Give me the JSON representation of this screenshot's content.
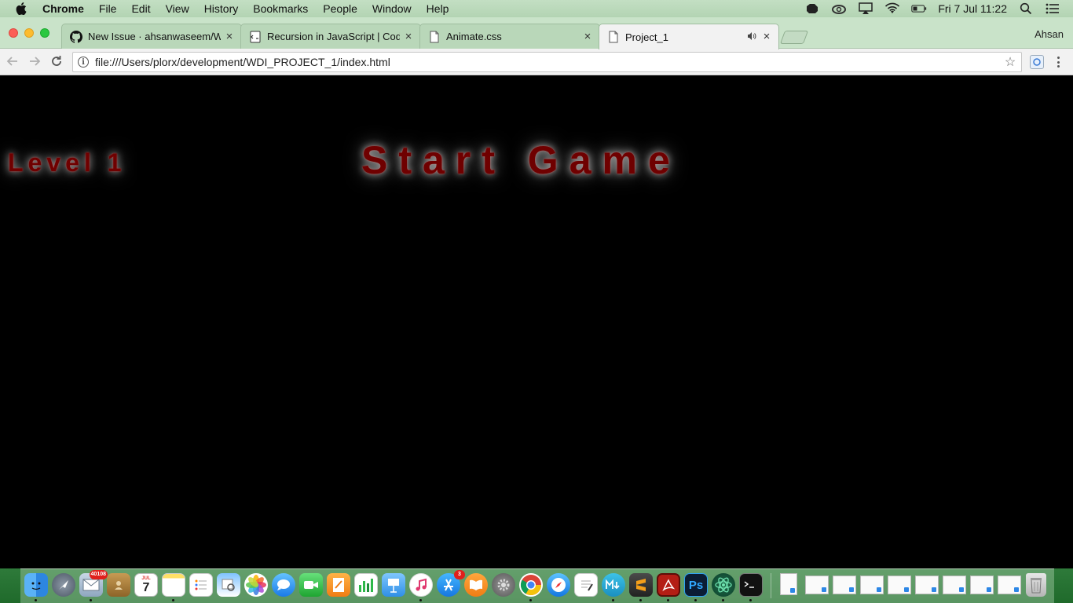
{
  "menubar": {
    "app_name": "Chrome",
    "items": [
      "File",
      "Edit",
      "View",
      "History",
      "Bookmarks",
      "People",
      "Window",
      "Help"
    ],
    "clock": "Fri 7 Jul  11:22"
  },
  "browser": {
    "profile": "Ahsan",
    "tabs": [
      {
        "title": "New Issue · ahsanwaseem/WD",
        "icon": "github-icon",
        "active": false
      },
      {
        "title": "Recursion in JavaScript | Code",
        "icon": "codepen-icon",
        "active": false
      },
      {
        "title": "Animate.css",
        "icon": "document-icon",
        "active": false
      },
      {
        "title": "Project_1",
        "icon": "document-icon",
        "active": true
      }
    ],
    "url": "file:///Users/plorx/development/WDI_PROJECT_1/index.html"
  },
  "page": {
    "level_label": "Level 1",
    "start_label": "Start Game",
    "text_color": "#6f0000",
    "glow_color": "#bdbdbd",
    "background": "#000000"
  },
  "dock": {
    "mail_badge": "40108",
    "appstore_badge": "3",
    "calendar_day": "7",
    "apps": [
      "finder-icon",
      "launchpad-icon",
      "mail-icon",
      "contacts-icon",
      "calendar-icon",
      "notes-icon",
      "reminders-icon",
      "preview-icon",
      "photos-icon",
      "messages-icon",
      "facetime-icon",
      "pages-icon",
      "numbers-icon",
      "keynote-icon",
      "itunes-icon",
      "appstore-icon",
      "ibooks-icon",
      "system-preferences-icon",
      "chrome-icon",
      "safari-icon",
      "textedit-icon",
      "markdown-icon",
      "sublime-text-icon",
      "acrobat-icon",
      "photoshop-icon",
      "atom-icon",
      "terminal-icon"
    ]
  }
}
